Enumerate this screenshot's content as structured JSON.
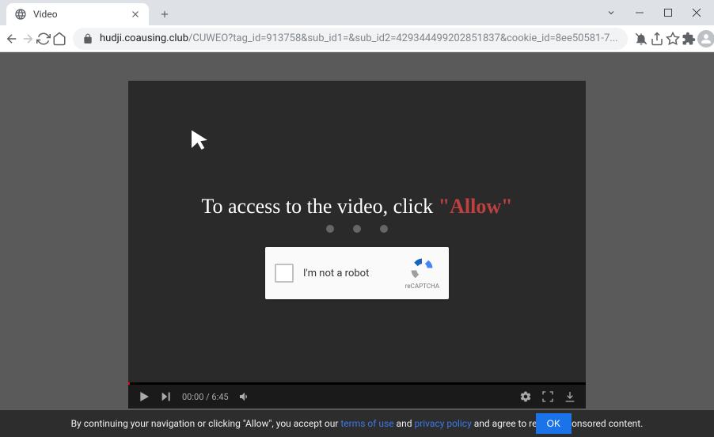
{
  "window": {
    "tab_title": "Video",
    "url_host": "hudji.coausing.club",
    "url_path": "/CUWEO?tag_id=913758&sub_id1=&sub_id2=429344499202851837&cookie_id=8ee50581-7..."
  },
  "video": {
    "access_prefix": "To access to the video, click ",
    "allow_word": "\"Allow\"",
    "captcha_label": "I'm not a robot",
    "captcha_brand": "reCAPTCHA",
    "time_current": "00:00",
    "time_separator": " / ",
    "time_total": "6:45"
  },
  "banner": {
    "text_1": "By continuing your navigation or clicking \"Allow\", you accept our ",
    "link_terms": "terms of use",
    "text_and": " and ",
    "link_privacy": "privacy policy",
    "text_2": " and agree to receive sponsored content.",
    "ok_label": "OK"
  }
}
